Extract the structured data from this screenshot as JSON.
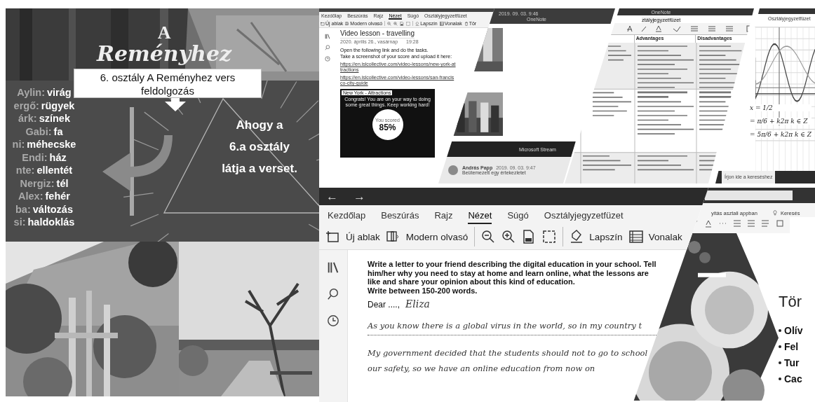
{
  "slide": {
    "title_small": "A",
    "title_script": "Reményhez",
    "caption": "6. osztály A Reményhez vers feldolgozás",
    "names": [
      {
        "name": "Aylin:",
        "word": "virág"
      },
      {
        "name": "ergő:",
        "word": "rügyek"
      },
      {
        "name": "árk:",
        "word": "színek"
      },
      {
        "name": "Gabi:",
        "word": "fa"
      },
      {
        "name": "ni:",
        "word": "méhecske"
      },
      {
        "name": "Endi:",
        "word": "ház"
      },
      {
        "name": "nte:",
        "word": "ellentét"
      },
      {
        "name": "Nergiz:",
        "word": "tél"
      },
      {
        "name": "Alex:",
        "word": "fehér"
      },
      {
        "name": "ba:",
        "word": "változás"
      },
      {
        "name": "si:",
        "word": "haldoklás"
      }
    ],
    "triangle_text": [
      "Ahogy a",
      "6.a osztály",
      "látja a verset."
    ]
  },
  "lesson_window": {
    "tabs": [
      {
        "label": "Kezdőlap",
        "selected": false
      },
      {
        "label": "Beszúrás",
        "selected": false
      },
      {
        "label": "Rajz",
        "selected": false
      },
      {
        "label": "Nézet",
        "selected": true
      },
      {
        "label": "Súgó",
        "selected": false
      },
      {
        "label": "Osztályjegyzetfüzet",
        "selected": false
      }
    ],
    "tools": [
      {
        "kind": "new-window",
        "label": "Új ablak"
      },
      {
        "kind": "reader",
        "label": "Modern olvasó"
      },
      {
        "kind": "divider"
      },
      {
        "kind": "zoom-out"
      },
      {
        "kind": "zoom-in"
      },
      {
        "kind": "page-width"
      },
      {
        "kind": "fit"
      },
      {
        "kind": "divider"
      },
      {
        "kind": "page-color",
        "label": "Lapszín"
      },
      {
        "kind": "rule-lines",
        "label": "Vonalak"
      },
      {
        "kind": "delete",
        "label": "Tör"
      }
    ],
    "page_title": "Video lesson - travelling",
    "date": "2020. április 26., vasárnap",
    "time": "19:28",
    "instructions": [
      "Open the following link and do the tasks.",
      "Take a screenshot of your score and upload it here:"
    ],
    "links": [
      "https://en.islcollective.com/video-lessons/new-york-attractions",
      "https://en.islcollective.com/video-lessons/san-francisco-city-guide"
    ],
    "video": {
      "title": "New York - Attractions",
      "message": "Congrats! You are on your way to doing some great things. Keep working hard!",
      "score_label": "You scored",
      "score": "85%"
    }
  },
  "stream_panel": {
    "timestamp": "2019. 09. 03. 9:46",
    "app": "OneNote",
    "player": "Microsoft Stream",
    "author": "András Papp",
    "time": "2019. 09. 03. 9:47",
    "message": "Beütemezett egy értekezletet"
  },
  "table_panel": {
    "app": "OneNote",
    "tab": "ztályjegyzetfüzet",
    "columns": [
      "Advantages",
      "Disadvantages"
    ]
  },
  "graph_panel": {
    "tab": "Osztályjegyzetfüzet",
    "math": [
      "x = 1/2",
      "= π/6 + k2π  k ∈ Z",
      "= 5π/6 + k2π  k ∈ Z"
    ],
    "taskbar_search": "Írjon ide a kereséshez"
  },
  "letter_window": {
    "nav": [
      "←",
      "→"
    ],
    "tabs": [
      {
        "label": "Kezdőlap",
        "selected": false
      },
      {
        "label": "Beszúrás",
        "selected": false
      },
      {
        "label": "Rajz",
        "selected": false
      },
      {
        "label": "Nézet",
        "selected": true
      },
      {
        "label": "Súgó",
        "selected": false
      },
      {
        "label": "Osztályjegyzetfüzet",
        "selected": false
      }
    ],
    "tools": [
      {
        "kind": "new-window",
        "label": "Új ablak"
      },
      {
        "kind": "reader",
        "label": "Modern olvasó"
      },
      {
        "kind": "divider"
      },
      {
        "kind": "zoom-out"
      },
      {
        "kind": "zoom-in"
      },
      {
        "kind": "page-width"
      },
      {
        "kind": "fit"
      },
      {
        "kind": "divider"
      },
      {
        "kind": "page-color",
        "label": "Lapszín"
      },
      {
        "kind": "rule-lines",
        "label": "Vonalak"
      }
    ],
    "sidebar": [
      {
        "kind": "library"
      },
      {
        "kind": "search"
      },
      {
        "kind": "history"
      }
    ],
    "task": [
      "Write a letter to your friend describing the digital education in your school. Tell him/her why you need to stay at home and learn online, what the lessons are like and share your opinion about this kind of education.",
      "Write between 150-200 words."
    ],
    "greeting": "Dear ....,",
    "recipient": "Eliza",
    "handwriting": [
      "As you know there is a global virus in the world, so in my country t",
      "My government decided that the students should not to go to school",
      "our safety, so we have an online education from now on"
    ]
  },
  "slides_window": {
    "open_in_app": "yitás asztali appban",
    "search": "Keresés",
    "heading": "Tör",
    "bullets": [
      "Olív",
      "Fel",
      "Tur",
      "Cac"
    ]
  }
}
